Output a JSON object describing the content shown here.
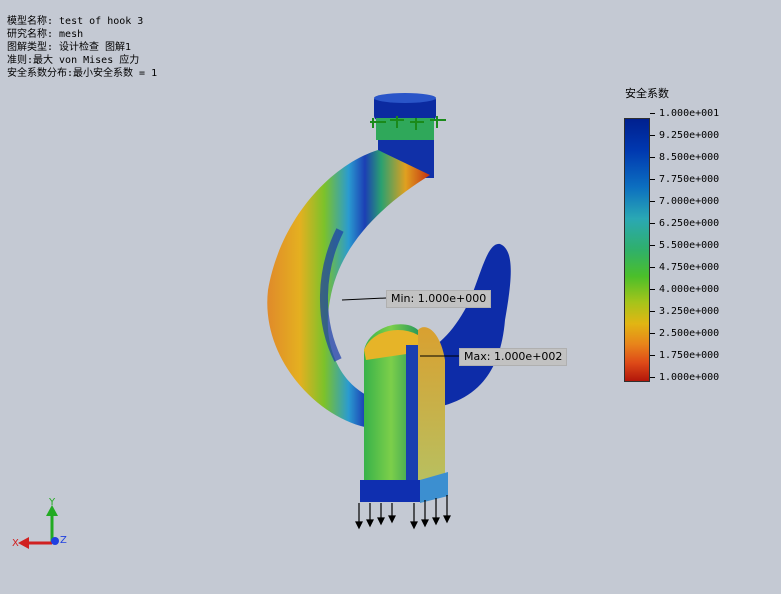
{
  "study_info": {
    "model_name": "模型名称: test of hook 3",
    "study_name": "研究名称: mesh",
    "plot_type": "图解类型: 设计检查 图解1",
    "criterion": "准则:最大 von Mises 应力",
    "fos_distribution": "安全系数分布:最小安全系数 = 1"
  },
  "legend": {
    "title": "安全系数",
    "ticks": [
      "1.000e+001",
      "9.250e+000",
      "8.500e+000",
      "7.750e+000",
      "7.000e+000",
      "6.250e+000",
      "5.500e+000",
      "4.750e+000",
      "4.000e+000",
      "3.250e+000",
      "2.500e+000",
      "1.750e+000",
      "1.000e+000"
    ]
  },
  "callouts": {
    "min": "Min: 1.000e+000",
    "max": "Max: 1.000e+002"
  },
  "triad": {
    "x": "X",
    "y": "Y",
    "z": "Z"
  },
  "colors": {
    "background": "#c4c9d3",
    "high_fos": "#00208f",
    "low_fos": "#b2160a"
  }
}
